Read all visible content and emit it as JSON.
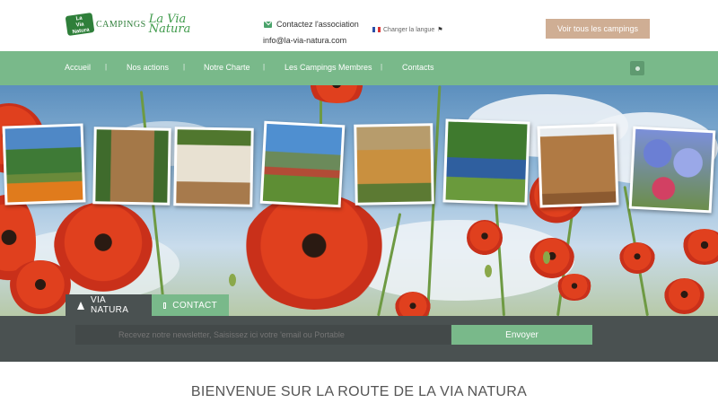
{
  "header": {
    "logo_badge": "Campings La Via Natura",
    "logo_campings": "CAMPINGS",
    "logo_name": "La Via Natura",
    "contact_label": "Contactez l'association",
    "email": "info@la-via-natura.com",
    "lang_label": "Changer la langue",
    "all_campings_button": "Voir tous les campings"
  },
  "nav": {
    "items": [
      "Accueil",
      "Nos actions",
      "Notre Charte",
      "Les Campings Membres",
      "Contacts"
    ],
    "separator": "|",
    "user_icon": "user-icon"
  },
  "hero": {
    "tabs": [
      {
        "label": "VIA NATURA",
        "icon": "tree-icon"
      },
      {
        "label": "CONTACT",
        "icon": "envelope-icon"
      }
    ],
    "photos": [
      "pumpkin-meadow",
      "insect-hotel",
      "bell-tent",
      "mountain-tipi",
      "straw-roof-cabin",
      "tents-in-meadow",
      "bird-house",
      "hydrangeas"
    ]
  },
  "newsletter": {
    "placeholder": "Recevez notre newsletter, Saisissez ici votre 'email ou Portable",
    "button": "Envoyer"
  },
  "main": {
    "welcome_title": "BIENVENUE SUR LA ROUTE DE LA VIA NATURA"
  },
  "colors": {
    "nav_green": "#79b98a",
    "dark_bar": "#4a5151",
    "button_tan": "#cfae94",
    "logo_green": "#2f7f3a"
  }
}
